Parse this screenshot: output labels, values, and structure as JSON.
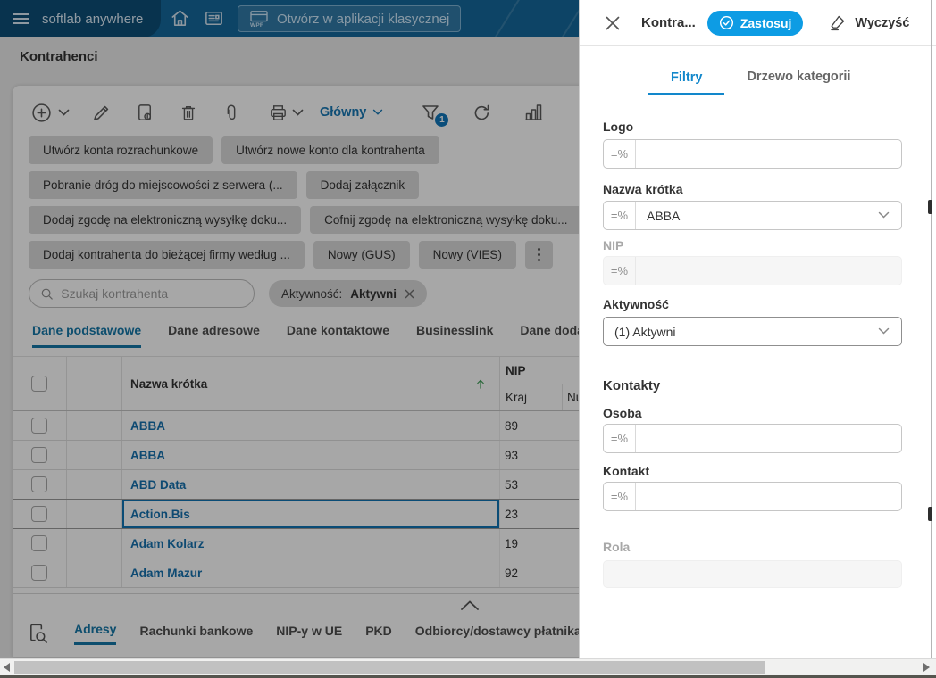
{
  "topbar": {
    "brand": "softlab anywhere",
    "classic_button": "Otwórz w aplikacji klasycznej",
    "wpf": "WPF"
  },
  "page": {
    "title": "Kontrahenci"
  },
  "toolbar": {
    "view": "Główny",
    "filter_count": "1"
  },
  "actions": [
    {
      "label": "Utwórz konta rozrachunkowe"
    },
    {
      "label": "Utwórz nowe konto dla kontrahenta"
    },
    {
      "label": "Pobranie dróg do miejscowości z serwera (..."
    },
    {
      "label": "Dodaj załącznik"
    },
    {
      "label": "Dodaj zgodę na elektroniczną wysyłkę doku..."
    },
    {
      "label": "Cofnij zgodę na elektroniczną wysyłkę doku..."
    },
    {
      "label": "Dodaj kontrahenta do bieżącej firmy według ..."
    },
    {
      "label": "Nowy (GUS)"
    },
    {
      "label": "Nowy (VIES)"
    }
  ],
  "search": {
    "placeholder": "Szukaj kontrahenta"
  },
  "chip": {
    "label": "Aktywność:",
    "value": "Aktywni"
  },
  "tabs": [
    {
      "label": "Dane podstawowe",
      "active": true
    },
    {
      "label": "Dane adresowe"
    },
    {
      "label": "Dane kontaktowe"
    },
    {
      "label": "Businesslink"
    },
    {
      "label": "Dane dodatkowe"
    }
  ],
  "table": {
    "headers": {
      "name": "Nazwa krótka",
      "nip": "NIP",
      "country": "Kraj",
      "number": "Numer"
    },
    "rows": [
      {
        "name": "ABBA",
        "nip": "89"
      },
      {
        "name": "ABBA",
        "nip": "93"
      },
      {
        "name": "ABD Data",
        "nip": "53"
      },
      {
        "name": "Action.Bis",
        "nip": "23",
        "selected": true
      },
      {
        "name": "Adam Kolarz",
        "nip": "19"
      },
      {
        "name": "Adam Mazur",
        "nip": "92"
      }
    ]
  },
  "footer_tabs": [
    {
      "label": "Adresy",
      "active": true
    },
    {
      "label": "Rachunki bankowe"
    },
    {
      "label": "NIP-y w UE"
    },
    {
      "label": "PKD"
    },
    {
      "label": "Odbiorcy/dostawcy płatnika"
    }
  ],
  "panel": {
    "title": "Kontra...",
    "apply": "Zastosuj",
    "clear": "Wyczyść",
    "tabs": [
      {
        "label": "Filtry",
        "active": true
      },
      {
        "label": "Drzewo kategorii"
      }
    ],
    "fields": {
      "logo": {
        "label": "Logo",
        "op": "=%",
        "value": ""
      },
      "short_name": {
        "label": "Nazwa krótka",
        "op": "=%",
        "value": "ABBA"
      },
      "nip": {
        "label": "NIP",
        "op": "=%",
        "value": ""
      },
      "activity": {
        "label": "Aktywność",
        "value": "(1) Aktywni"
      },
      "contacts_section": "Kontakty",
      "person": {
        "label": "Osoba",
        "op": "=%",
        "value": ""
      },
      "contact": {
        "label": "Kontakt",
        "op": "=%",
        "value": ""
      },
      "role": {
        "label": "Rola",
        "value": ""
      }
    }
  },
  "colors": {
    "accent": "#0d9ce4",
    "link": "#1671af",
    "active_tab": "#1577a8",
    "panel_tab": "#1287cb",
    "badge": "#1076ba",
    "sort_arrow": "#3f9e58",
    "topbar": "#15699c"
  }
}
